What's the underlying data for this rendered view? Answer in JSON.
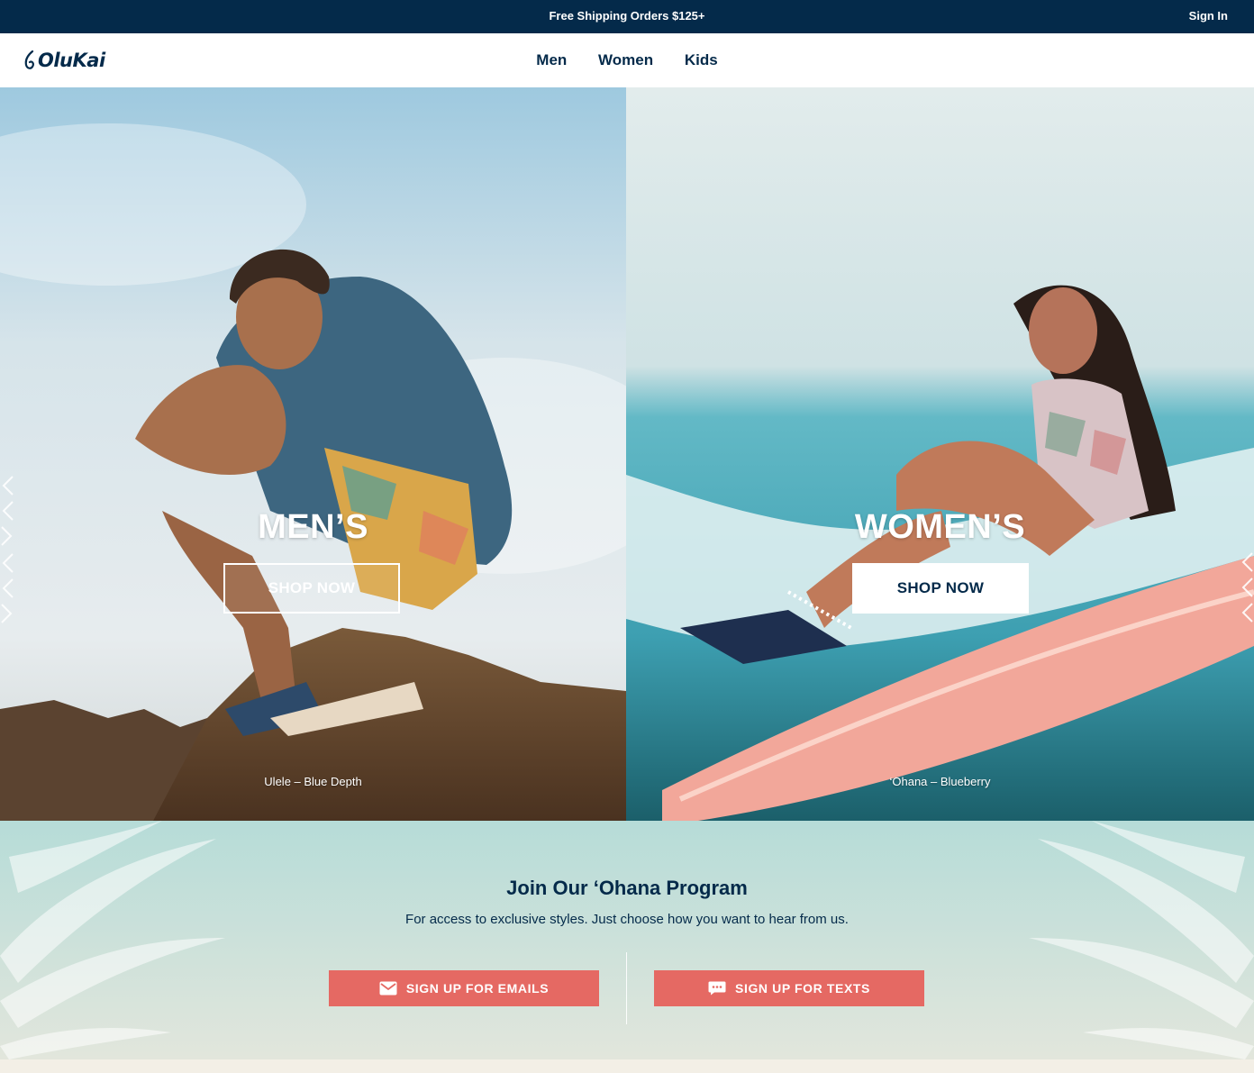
{
  "topbar": {
    "promo": "Free Shipping Orders $125+",
    "sign_in": "Sign In"
  },
  "brand": {
    "logo_text": "OluKai",
    "color": "#042a4a"
  },
  "nav": {
    "items": [
      {
        "label": "Men"
      },
      {
        "label": "Women"
      },
      {
        "label": "Kids"
      }
    ]
  },
  "hero": {
    "men": {
      "title": "MEN’S",
      "button": "SHOP NOW",
      "caption": "Ulele – Blue Depth"
    },
    "women": {
      "title": "WOMEN’S",
      "button": "SHOP NOW",
      "caption": "‘Ohana – Blueberry"
    }
  },
  "ohana": {
    "title": "Join Our ‘Ohana Program",
    "subtitle": "For access to exclusive styles. Just choose how you want to hear from us.",
    "email_button": "SIGN UP FOR EMAILS",
    "text_button": "SIGN UP FOR TEXTS",
    "button_color": "#e56963"
  },
  "icons": [
    "logo-mark-icon",
    "chevron-pattern-icon",
    "mail-icon",
    "chat-icon",
    "palm-leaf-icon"
  ]
}
